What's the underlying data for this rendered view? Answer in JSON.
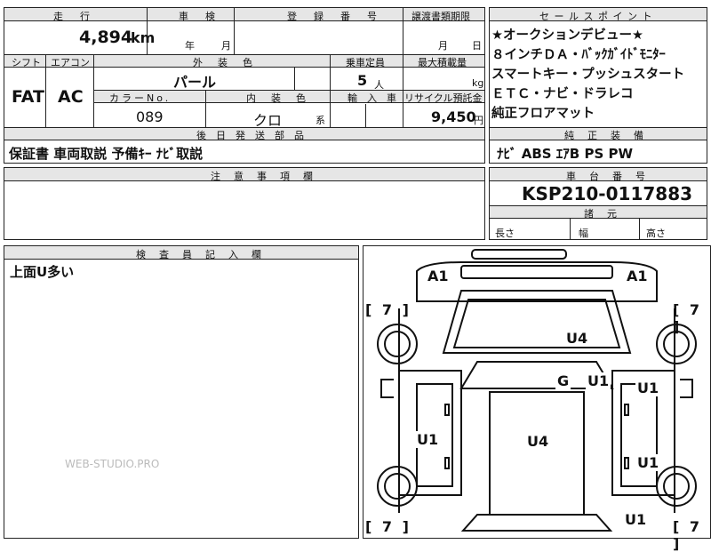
{
  "top_left": {
    "headers": {
      "mileage": "走　行",
      "inspection": "車　検",
      "registration_no": "登　録　番　号",
      "transfer_deadline": "譲渡書類期限",
      "shift": "シフト",
      "aircon": "エアコン",
      "exterior_color": "外　装　色",
      "capacity": "乗車定員",
      "max_load": "最大積載量",
      "color_no": "カラーNo.",
      "interior_color": "内　装　色",
      "import": "輸　入　車",
      "recycle_fee": "リサイクル預託金",
      "post_delivery_parts": "後　日　発　送　部　品"
    },
    "values": {
      "mileage": "4,894",
      "mileage_unit": "km",
      "year_unit": "年",
      "month_unit": "月",
      "transfer_month": "月",
      "transfer_day": "日",
      "shift": "FAT",
      "aircon": "AC",
      "exterior_color": "パール",
      "capacity": "5",
      "capacity_unit": "人",
      "max_load_unit": "kg",
      "color_no": "089",
      "interior_color": "クロ",
      "interior_suffix": "系",
      "recycle_fee": "9,450",
      "recycle_unit": "円",
      "post_delivery_parts": "保証書  車両取説  予備ｷｰ  ﾅﾋﾞ取説"
    }
  },
  "sales_points": {
    "header": "セ ー ル ス ポ イ ン ト",
    "lines": [
      "★オークションデビュー★",
      "８インチＤＡ・ﾊﾞｯｸｶﾞｲﾄﾞﾓﾆﾀｰ",
      "スマートキー・プッシュスタート",
      "ＥＴＣ・ナビ・ドラレコ",
      "純正フロアマット"
    ]
  },
  "genuine_equipment": {
    "header": "純　正　装　備",
    "value": "ﾅﾋﾞ  ABS  ｴｱB  PS  PW"
  },
  "notes": {
    "header": "注　意　事　項　欄"
  },
  "chassis": {
    "header": "車　台　番　号",
    "value": "KSP210-0117883"
  },
  "dimensions": {
    "header": "諸　元",
    "length": "長さ",
    "width": "幅",
    "height": "高さ"
  },
  "inspector": {
    "header": "検　査　員　記　入　欄",
    "comment": "上面U多い"
  },
  "diagram": {
    "marks": {
      "a1_left": "A1",
      "a1_right": "A1",
      "u4_top": "U4",
      "g": "G",
      "u1_mid": "U1",
      "u1_right_upper": "U1",
      "u1_left": "U1",
      "u4_center": "U4",
      "u1_right_lower": "U1",
      "u1_bottom": "U1"
    },
    "brackets": {
      "tl": "[ 7 ]",
      "tr": "[ 7 ]",
      "bl": "[ 7 ]",
      "br": "[ 7 ]"
    }
  },
  "watermark": "WEB-STUDIO.PRO"
}
